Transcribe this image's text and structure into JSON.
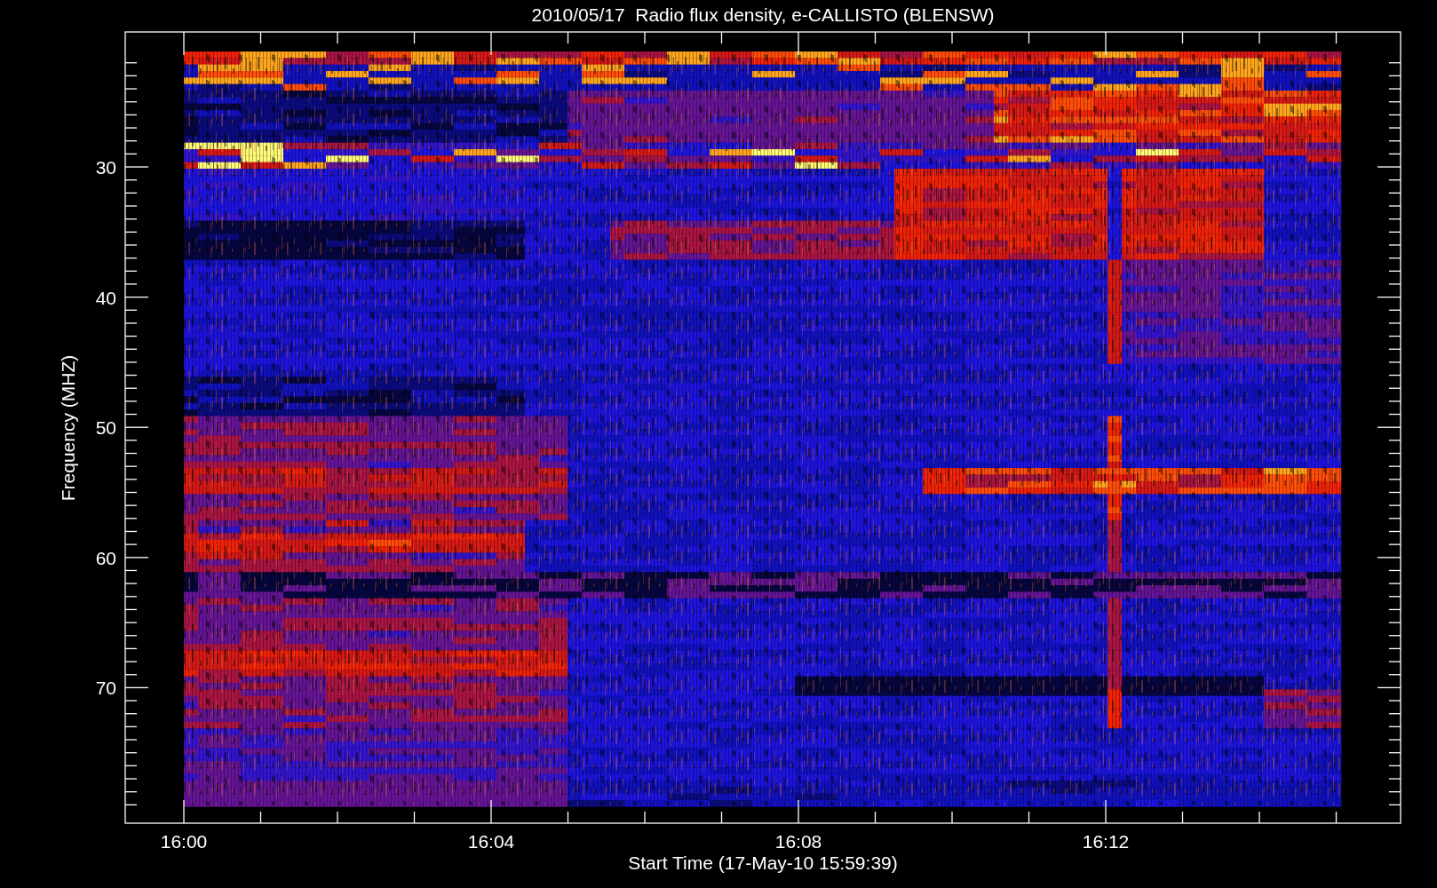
{
  "title": "2010/05/17  Radio flux density, e-CALLISTO (BLENSW)",
  "xlabel": "Start Time (17-May-10 15:59:39)",
  "ylabel": "Frequency (MHZ)",
  "xtick_labels": [
    "16:00",
    "16:04",
    "16:08",
    "16:12"
  ],
  "ytick_labels": [
    "30",
    "40",
    "50",
    "60",
    "70"
  ]
}
